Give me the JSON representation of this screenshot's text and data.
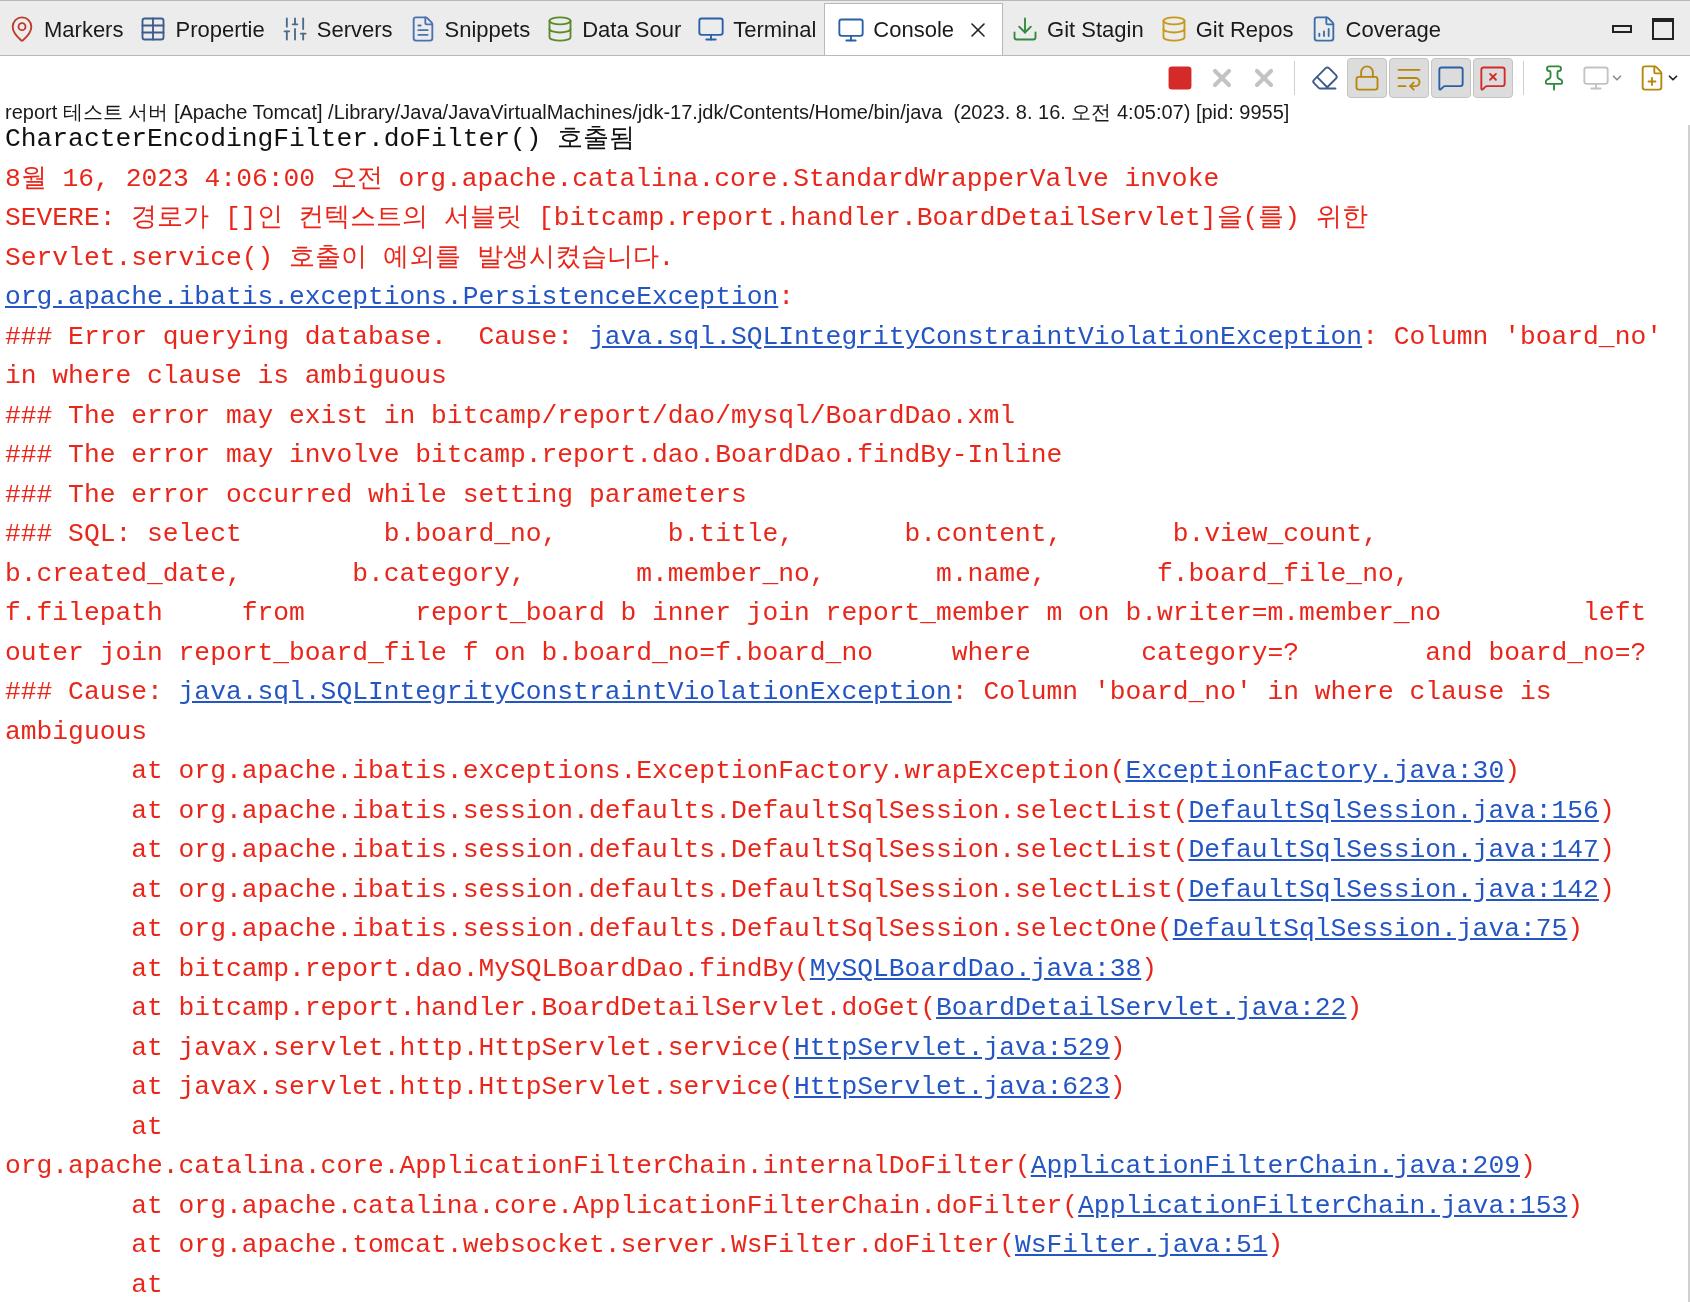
{
  "tabs": [
    {
      "label": "Markers",
      "selected": false
    },
    {
      "label": "Propertie",
      "selected": false
    },
    {
      "label": "Servers",
      "selected": false
    },
    {
      "label": "Snippets",
      "selected": false
    },
    {
      "label": "Data Sour",
      "selected": false
    },
    {
      "label": "Terminal",
      "selected": false
    },
    {
      "label": "Console",
      "selected": true
    },
    {
      "label": "Git Stagin",
      "selected": false
    },
    {
      "label": "Git Repos",
      "selected": false
    },
    {
      "label": "Coverage",
      "selected": false
    }
  ],
  "toolbar": [
    {
      "kind": "terminate",
      "disabled": false,
      "pressed": false
    },
    {
      "kind": "remove",
      "disabled": true,
      "pressed": false
    },
    {
      "kind": "remove-all",
      "disabled": true,
      "pressed": false
    },
    {
      "kind": "clear",
      "disabled": false,
      "pressed": false
    },
    {
      "kind": "scroll-lock",
      "disabled": false,
      "pressed": true
    },
    {
      "kind": "word-wrap",
      "disabled": false,
      "pressed": true
    },
    {
      "kind": "show-out",
      "disabled": false,
      "pressed": true
    },
    {
      "kind": "show-err",
      "disabled": false,
      "pressed": true
    },
    {
      "kind": "pin",
      "disabled": false,
      "pressed": false
    },
    {
      "kind": "display",
      "disabled": true,
      "pressed": false,
      "dropdown": true
    },
    {
      "kind": "open",
      "disabled": false,
      "pressed": false,
      "dropdown": true
    }
  ],
  "process_label": "report 테스트 서버 [Apache Tomcat] /Library/Java/JavaVirtualMachines/jdk-17.jdk/Contents/Home/bin/java  (2023. 8. 16. 오전 4:05:07) [pid: 9955]",
  "console_lines": [
    {
      "kind": "stdout",
      "segments": [
        {
          "kind": "text",
          "text": "CharacterEncodingFilter.doFilter() 호출됨"
        }
      ]
    },
    {
      "kind": "stderr",
      "segments": [
        {
          "kind": "text",
          "text": "8월 16, 2023 4:06:00 오전 org.apache.catalina.core.StandardWrapperValve invoke"
        }
      ]
    },
    {
      "kind": "stderr",
      "segments": [
        {
          "kind": "text",
          "text": "SEVERE: 경로가 []인 컨텍스트의 서블릿 [bitcamp.report.handler.BoardDetailServlet]을(를) 위한"
        }
      ]
    },
    {
      "kind": "stderr",
      "segments": [
        {
          "kind": "text",
          "text": "Servlet.service() 호출이 예외를 발생시켰습니다."
        }
      ]
    },
    {
      "kind": "stderr",
      "segments": [
        {
          "kind": "link",
          "text": "org.apache.ibatis.exceptions.PersistenceException"
        },
        {
          "kind": "text",
          "text": ":"
        }
      ]
    },
    {
      "kind": "stderr",
      "segments": [
        {
          "kind": "text",
          "text": "### Error querying database.  Cause: "
        },
        {
          "kind": "link",
          "text": "java.sql.SQLIntegrityConstraintViolationException"
        },
        {
          "kind": "text",
          "text": ": Column 'board_no'"
        }
      ]
    },
    {
      "kind": "stderr",
      "segments": [
        {
          "kind": "text",
          "text": "in where clause is ambiguous"
        }
      ]
    },
    {
      "kind": "stderr",
      "segments": [
        {
          "kind": "text",
          "text": "### The error may exist in bitcamp/report/dao/mysql/BoardDao.xml"
        }
      ]
    },
    {
      "kind": "stderr",
      "segments": [
        {
          "kind": "text",
          "text": "### The error may involve bitcamp.report.dao.BoardDao.findBy-Inline"
        }
      ]
    },
    {
      "kind": "stderr",
      "segments": [
        {
          "kind": "text",
          "text": "### The error occurred while setting parameters"
        }
      ]
    },
    {
      "kind": "stderr",
      "segments": [
        {
          "kind": "text",
          "text": "### SQL: select         b.board_no,       b.title,       b.content,       b.view_count,"
        }
      ]
    },
    {
      "kind": "stderr",
      "segments": [
        {
          "kind": "text",
          "text": "b.created_date,       b.category,       m.member_no,       m.name,       f.board_file_no,"
        }
      ]
    },
    {
      "kind": "stderr",
      "segments": [
        {
          "kind": "text",
          "text": "f.filepath     from       report_board b inner join report_member m on b.writer=m.member_no         left"
        }
      ]
    },
    {
      "kind": "stderr",
      "segments": [
        {
          "kind": "text",
          "text": "outer join report_board_file f on b.board_no=f.board_no     where       category=?        and board_no=?"
        }
      ]
    },
    {
      "kind": "stderr",
      "segments": [
        {
          "kind": "text",
          "text": "### Cause: "
        },
        {
          "kind": "link",
          "text": "java.sql.SQLIntegrityConstraintViolationException"
        },
        {
          "kind": "text",
          "text": ": Column 'board_no' in where clause is"
        }
      ]
    },
    {
      "kind": "stderr",
      "segments": [
        {
          "kind": "text",
          "text": "ambiguous"
        }
      ]
    },
    {
      "kind": "stderr",
      "segments": [
        {
          "kind": "text",
          "text": "\tat org.apache.ibatis.exceptions.ExceptionFactory.wrapException("
        },
        {
          "kind": "link",
          "text": "ExceptionFactory.java:30"
        },
        {
          "kind": "text",
          "text": ")"
        }
      ]
    },
    {
      "kind": "stderr",
      "segments": [
        {
          "kind": "text",
          "text": "\tat org.apache.ibatis.session.defaults.DefaultSqlSession.selectList("
        },
        {
          "kind": "link",
          "text": "DefaultSqlSession.java:156"
        },
        {
          "kind": "text",
          "text": ")"
        }
      ]
    },
    {
      "kind": "stderr",
      "segments": [
        {
          "kind": "text",
          "text": "\tat org.apache.ibatis.session.defaults.DefaultSqlSession.selectList("
        },
        {
          "kind": "link",
          "text": "DefaultSqlSession.java:147"
        },
        {
          "kind": "text",
          "text": ")"
        }
      ]
    },
    {
      "kind": "stderr",
      "segments": [
        {
          "kind": "text",
          "text": "\tat org.apache.ibatis.session.defaults.DefaultSqlSession.selectList("
        },
        {
          "kind": "link",
          "text": "DefaultSqlSession.java:142"
        },
        {
          "kind": "text",
          "text": ")"
        }
      ]
    },
    {
      "kind": "stderr",
      "segments": [
        {
          "kind": "text",
          "text": "\tat org.apache.ibatis.session.defaults.DefaultSqlSession.selectOne("
        },
        {
          "kind": "link",
          "text": "DefaultSqlSession.java:75"
        },
        {
          "kind": "text",
          "text": ")"
        }
      ]
    },
    {
      "kind": "stderr",
      "segments": [
        {
          "kind": "text",
          "text": "\tat bitcamp.report.dao.MySQLBoardDao.findBy("
        },
        {
          "kind": "link",
          "text": "MySQLBoardDao.java:38"
        },
        {
          "kind": "text",
          "text": ")"
        }
      ]
    },
    {
      "kind": "stderr",
      "segments": [
        {
          "kind": "text",
          "text": "\tat bitcamp.report.handler.BoardDetailServlet.doGet("
        },
        {
          "kind": "link",
          "text": "BoardDetailServlet.java:22"
        },
        {
          "kind": "text",
          "text": ")"
        }
      ]
    },
    {
      "kind": "stderr",
      "segments": [
        {
          "kind": "text",
          "text": "\tat javax.servlet.http.HttpServlet.service("
        },
        {
          "kind": "link",
          "text": "HttpServlet.java:529"
        },
        {
          "kind": "text",
          "text": ")"
        }
      ]
    },
    {
      "kind": "stderr",
      "segments": [
        {
          "kind": "text",
          "text": "\tat javax.servlet.http.HttpServlet.service("
        },
        {
          "kind": "link",
          "text": "HttpServlet.java:623"
        },
        {
          "kind": "text",
          "text": ")"
        }
      ]
    },
    {
      "kind": "stderr",
      "segments": [
        {
          "kind": "text",
          "text": "\tat"
        }
      ]
    },
    {
      "kind": "stderr",
      "segments": [
        {
          "kind": "text",
          "text": "org.apache.catalina.core.ApplicationFilterChain.internalDoFilter("
        },
        {
          "kind": "link",
          "text": "ApplicationFilterChain.java:209"
        },
        {
          "kind": "text",
          "text": ")"
        }
      ]
    },
    {
      "kind": "stderr",
      "segments": [
        {
          "kind": "text",
          "text": "\tat org.apache.catalina.core.ApplicationFilterChain.doFilter("
        },
        {
          "kind": "link",
          "text": "ApplicationFilterChain.java:153"
        },
        {
          "kind": "text",
          "text": ")"
        }
      ]
    },
    {
      "kind": "stderr",
      "segments": [
        {
          "kind": "text",
          "text": "\tat org.apache.tomcat.websocket.server.WsFilter.doFilter("
        },
        {
          "kind": "link",
          "text": "WsFilter.java:51"
        },
        {
          "kind": "text",
          "text": ")"
        }
      ]
    },
    {
      "kind": "stderr",
      "segments": [
        {
          "kind": "text",
          "text": "\tat"
        }
      ]
    }
  ]
}
